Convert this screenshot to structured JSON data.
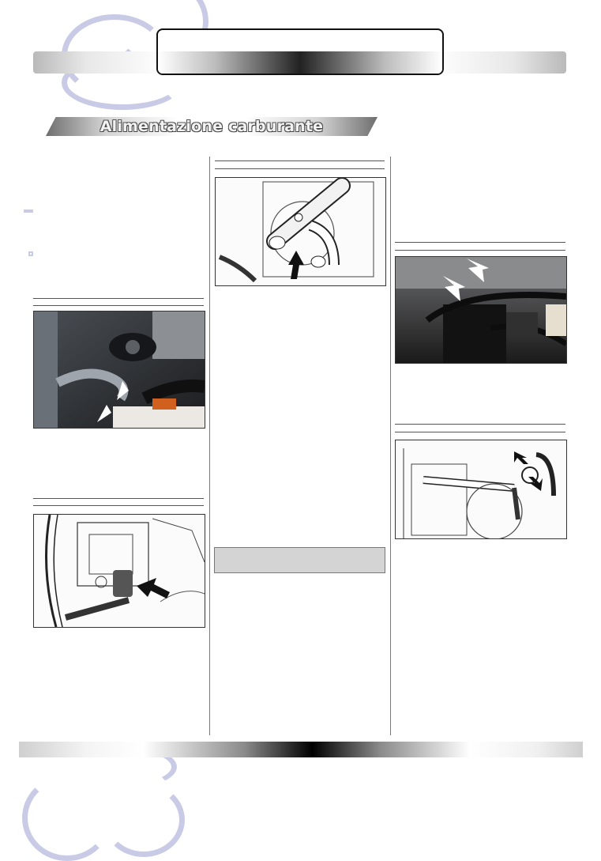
{
  "section": {
    "title": "Alimentazione carburante"
  },
  "colors": {
    "watermark": "#c9cbe6",
    "note_box": "#d4d4d4",
    "arrow_white": "#ffffff",
    "arrow_black": "#111111"
  },
  "figures": [
    {
      "kind": "photo",
      "subject": "engine bay with fuel hose, two white arrows"
    },
    {
      "kind": "drawing",
      "subject": "connector on engine block, black arrow"
    },
    {
      "kind": "drawing",
      "subject": "fuel rail with locking tool, black arrow"
    },
    {
      "kind": "photo",
      "subject": "fuel filter area, two white arrows"
    },
    {
      "kind": "drawing",
      "subject": "fuel filter lines, two double black arrows"
    }
  ],
  "icons": [
    "watermark-arc",
    "arrow-white",
    "arrow-black",
    "double-arrow-black"
  ]
}
